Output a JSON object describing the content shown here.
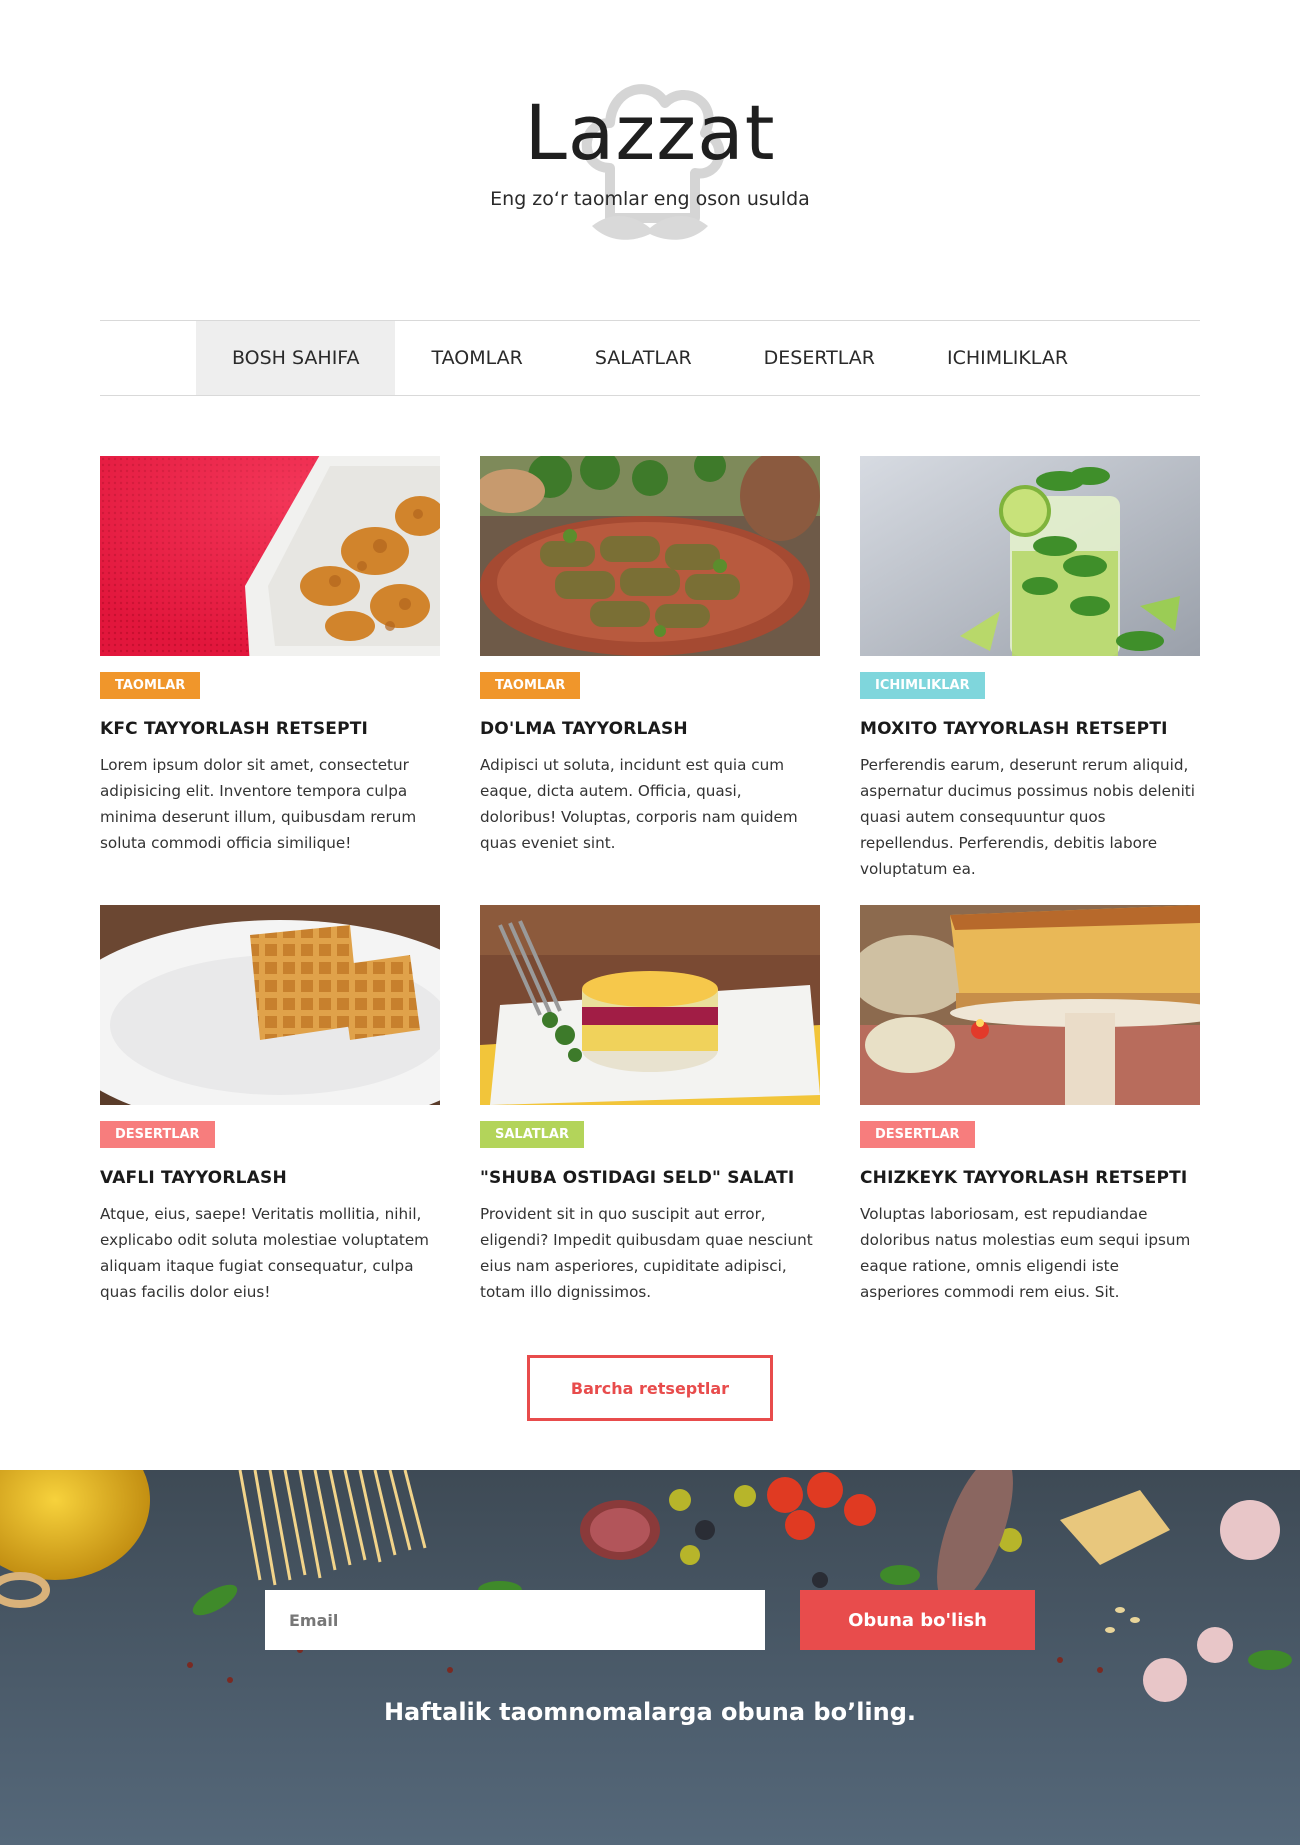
{
  "brand": {
    "title": "Lazzat",
    "tagline": "Eng zo‘r taomlar eng oson usulda"
  },
  "nav": {
    "items": [
      {
        "label": "BOSH SAHIFA",
        "active": true
      },
      {
        "label": "TAOMLAR",
        "active": false
      },
      {
        "label": "SALATLAR",
        "active": false
      },
      {
        "label": "DESERTLAR",
        "active": false
      },
      {
        "label": "ICHIMLIKLAR",
        "active": false
      }
    ]
  },
  "posts": [
    {
      "image": "fried-chicken-photo",
      "category": "TAOMLAR",
      "category_color": "#f0962b",
      "title": "KFC TAYYORLASH RETSEPTI",
      "excerpt": "Lorem ipsum dolor sit amet, consectetur adipisicing elit. Inventore tempora culpa minima deserunt illum, quibusdam rerum soluta commodi officia similique!"
    },
    {
      "image": "dolma-photo",
      "category": "TAOMLAR",
      "category_color": "#f0962b",
      "title": "DO'LMA TAYYORLASH",
      "excerpt": "Adipisci ut soluta, incidunt est quia cum eaque, dicta autem. Officia, quasi, doloribus! Voluptas, corporis nam quidem quas eveniet sint."
    },
    {
      "image": "mojito-photo",
      "category": "ICHIMLIKLAR",
      "category_color": "#7fd6dc",
      "title": "MOXITO TAYYORLASH RETSEPTI",
      "excerpt": "Perferendis earum, deserunt rerum aliquid, aspernatur ducimus possimus nobis deleniti quasi autem consequuntur quos repellendus. Perferendis, debitis labore voluptatum ea."
    },
    {
      "image": "waffle-photo",
      "category": "DESERTLAR",
      "category_color": "#f77d7d",
      "title": "VAFLI TAYYORLASH",
      "excerpt": "Atque, eius, saepe! Veritatis mollitia, nihil, explicabo odit soluta molestiae voluptatem aliquam itaque fugiat consequatur, culpa quas facilis dolor eius!"
    },
    {
      "image": "shuba-salad-photo",
      "category": "SALATLAR",
      "category_color": "#b3d45a",
      "title": "\"SHUBA OSTIDAGI SELD\" SALATI",
      "excerpt": "Provident sit in quo suscipit aut error, eligendi? Impedit quibusdam quae nesciunt eius nam asperiores, cupiditate adipisci, totam illo dignissimos."
    },
    {
      "image": "cheesecake-photo",
      "category": "DESERTLAR",
      "category_color": "#f77d7d",
      "title": "CHIZKEYK TAYYORLASH RETSEPTI",
      "excerpt": "Voluptas laboriosam, est repudiandae doloribus natus molestias eum sequi ipsum eaque ratione, omnis eligendi iste asperiores commodi rem eius. Sit."
    }
  ],
  "more_button": {
    "label": "Barcha retseptlar"
  },
  "subscribe": {
    "placeholder": "Email",
    "button_label": "Obuna bo'lish",
    "caption": "Haftalik taomnomalarga obuna bo’ling."
  },
  "colors": {
    "accent": "#e84c4c",
    "nav_active_bg": "#eeeeee",
    "footer_bg": "#4a5868"
  }
}
